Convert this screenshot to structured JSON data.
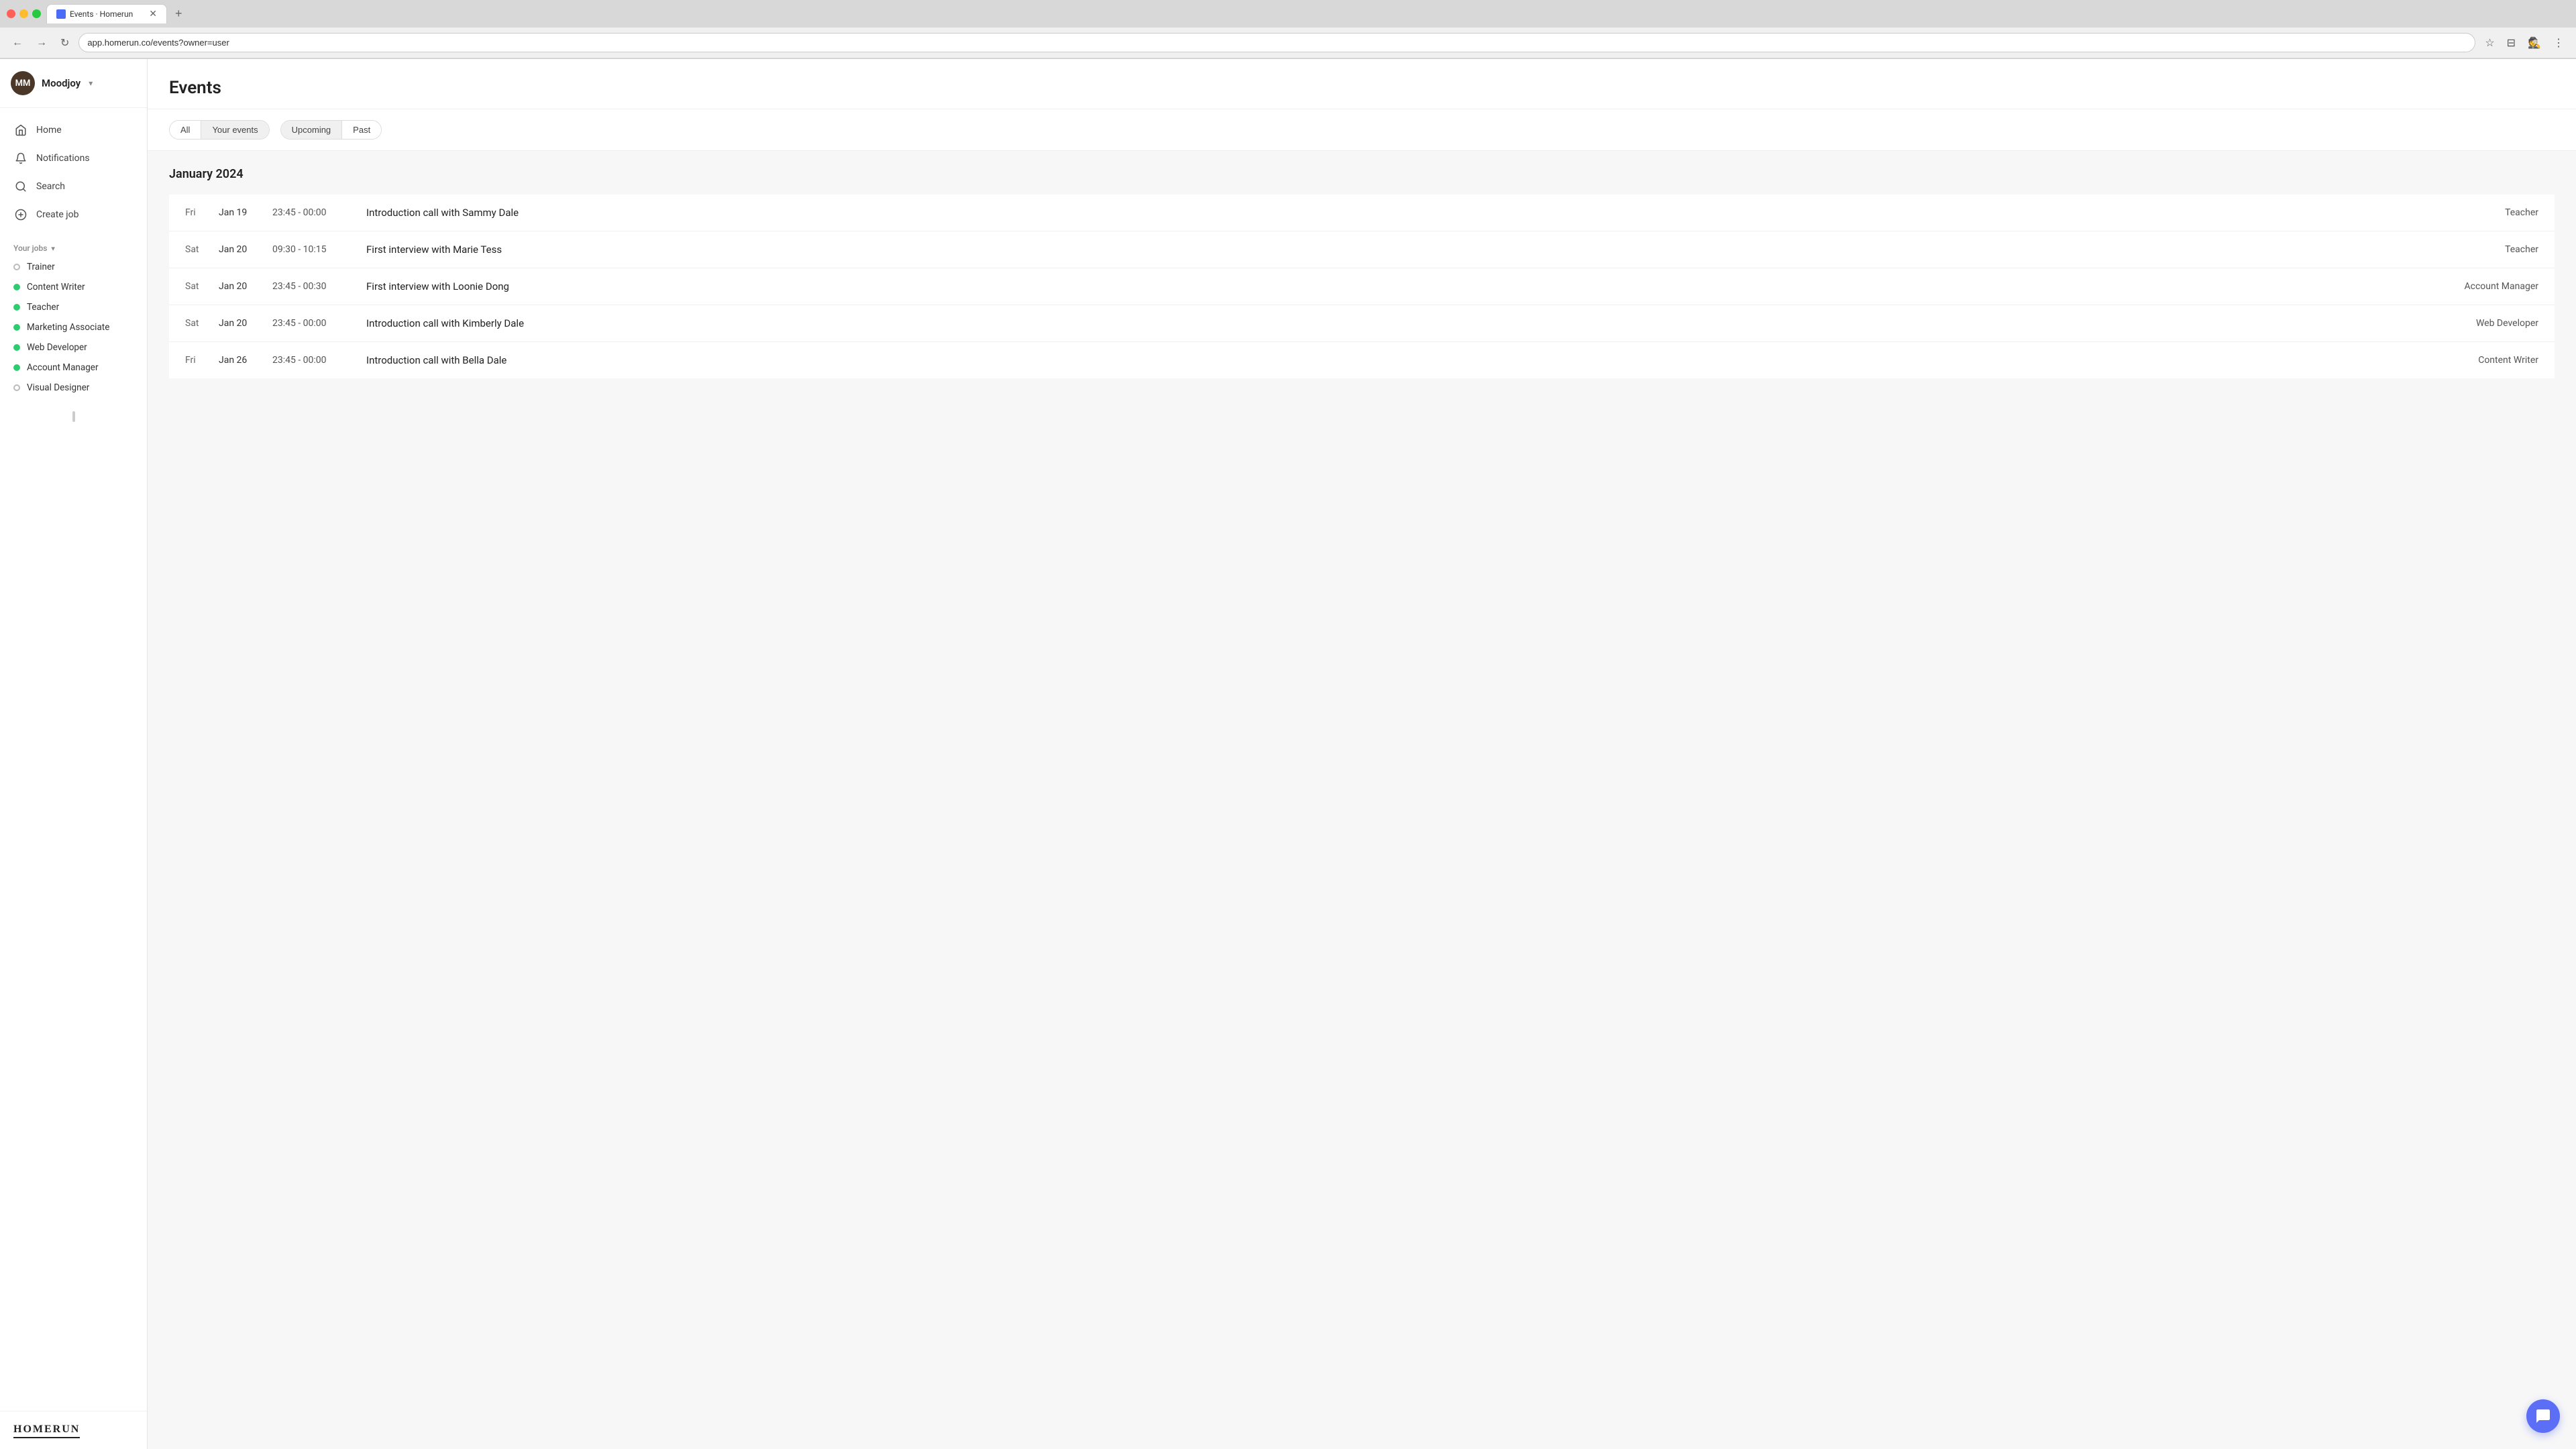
{
  "browser": {
    "tab_title": "Events · Homerun",
    "tab_new_label": "+",
    "address": "app.homerun.co/events?owner=user",
    "incognito_label": "Incognito"
  },
  "sidebar": {
    "user": {
      "initials": "MM",
      "name": "Moodjoy",
      "chevron": "▾"
    },
    "nav_items": [
      {
        "id": "home",
        "label": "Home",
        "icon": "home"
      },
      {
        "id": "notifications",
        "label": "Notifications",
        "icon": "bell"
      },
      {
        "id": "search",
        "label": "Search",
        "icon": "search"
      },
      {
        "id": "create-job",
        "label": "Create job",
        "icon": "plus-circle"
      }
    ],
    "jobs_section_label": "Your jobs",
    "jobs": [
      {
        "label": "Trainer",
        "dot": "empty"
      },
      {
        "label": "Content Writer",
        "dot": "green"
      },
      {
        "label": "Teacher",
        "dot": "green"
      },
      {
        "label": "Marketing Associate",
        "dot": "green"
      },
      {
        "label": "Web Developer",
        "dot": "green"
      },
      {
        "label": "Account Manager",
        "dot": "green"
      },
      {
        "label": "Visual Designer",
        "dot": "empty"
      }
    ],
    "logo": "HOMERUN"
  },
  "main": {
    "page_title": "Events",
    "filters": {
      "group1": [
        {
          "label": "All",
          "active": false
        },
        {
          "label": "Your events",
          "active": true
        }
      ],
      "group2": [
        {
          "label": "Upcoming",
          "active": true
        },
        {
          "label": "Past",
          "active": false
        }
      ]
    },
    "month_label": "January 2024",
    "events": [
      {
        "day": "Fri",
        "date": "Jan 19",
        "time": "23:45 - 00:00",
        "name": "Introduction call with Sammy Dale",
        "job": "Teacher"
      },
      {
        "day": "Sat",
        "date": "Jan 20",
        "time": "09:30 - 10:15",
        "name": "First interview with Marie Tess",
        "job": "Teacher"
      },
      {
        "day": "Sat",
        "date": "Jan 20",
        "time": "23:45 - 00:30",
        "name": "First interview with Loonie Dong",
        "job": "Account Manager"
      },
      {
        "day": "Sat",
        "date": "Jan 20",
        "time": "23:45 - 00:00",
        "name": "Introduction call with Kimberly Dale",
        "job": "Web Developer"
      },
      {
        "day": "Fri",
        "date": "Jan 26",
        "time": "23:45 - 00:00",
        "name": "Introduction call with Bella Dale",
        "job": "Content Writer"
      }
    ]
  }
}
